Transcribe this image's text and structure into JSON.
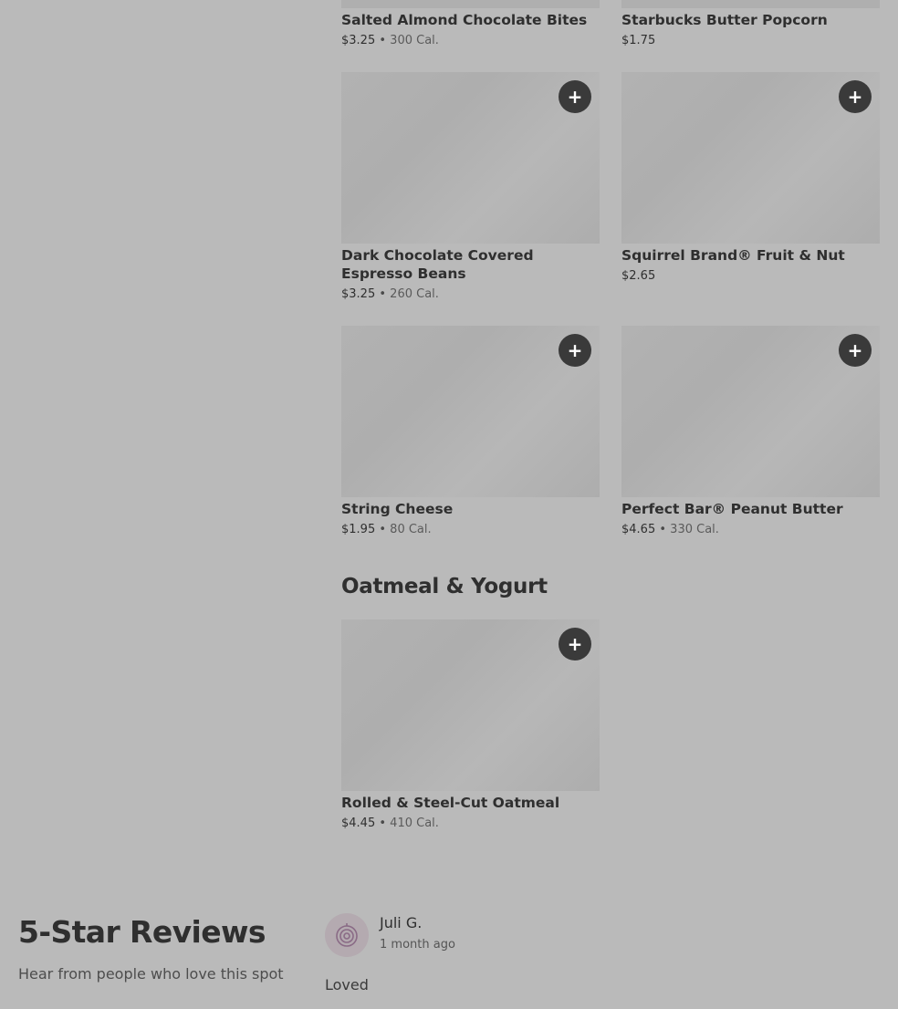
{
  "menu": {
    "top_items": [
      {
        "name": "Salted Almond Chocolate Bites",
        "price": "$3.25",
        "calories": "300 Cal."
      },
      {
        "name": "Starbucks Butter Popcorn",
        "price": "$1.75",
        "calories": ""
      }
    ],
    "items": [
      {
        "name": "Dark Chocolate Covered Espresso Beans",
        "price": "$3.25",
        "calories": "260 Cal."
      },
      {
        "name": "Squirrel Brand® Fruit & Nut",
        "price": "$2.65",
        "calories": ""
      },
      {
        "name": "String Cheese",
        "price": "$1.95",
        "calories": "80 Cal."
      },
      {
        "name": "Perfect Bar® Peanut Butter",
        "price": "$4.65",
        "calories": "330 Cal."
      }
    ],
    "section_title": "Oatmeal & Yogurt",
    "section_items": [
      {
        "name": "Rolled & Steel-Cut Oatmeal",
        "price": "$4.45",
        "calories": "410 Cal."
      }
    ],
    "separator": "•",
    "add_icon": "plus-icon",
    "add_glyph": "+"
  },
  "reviews": {
    "title": "5-Star Reviews",
    "subtitle": "Hear from people who love this spot",
    "review": {
      "author": "Juli G.",
      "time": "1 month ago",
      "text": "Loved"
    }
  }
}
